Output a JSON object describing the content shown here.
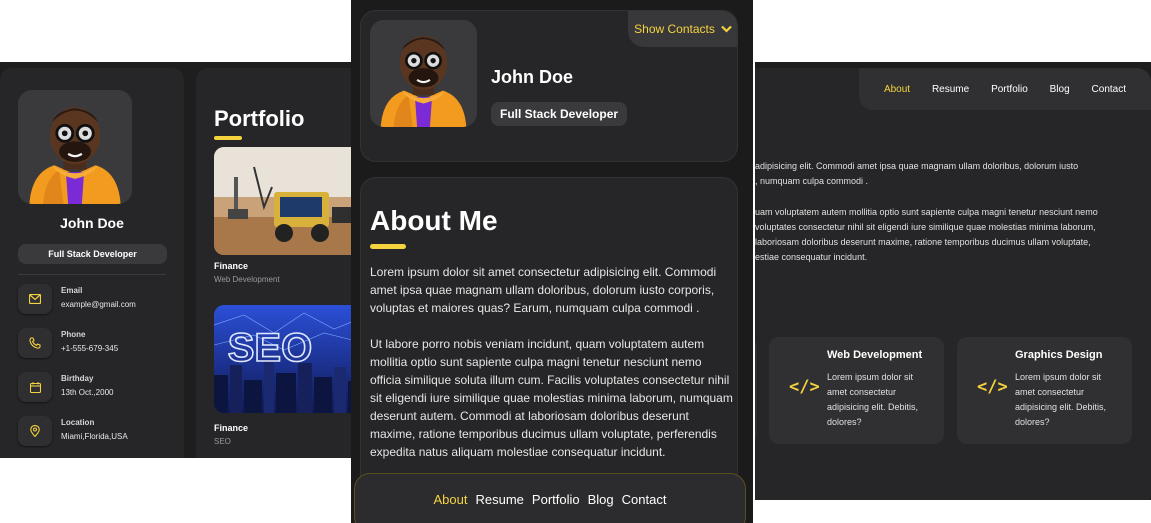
{
  "name": "John Doe",
  "role": "Full Stack Developer",
  "contacts": [
    {
      "label": "Email",
      "value": "example@gmail.com",
      "icon": "mail-icon"
    },
    {
      "label": "Phone",
      "value": "+1-555-679-345",
      "icon": "phone-icon"
    },
    {
      "label": "Birthday",
      "value": "13th Oct.,2000",
      "icon": "calendar-icon"
    },
    {
      "label": "Location",
      "value": "Miami,Florida,USA",
      "icon": "location-pin-icon"
    }
  ],
  "portfolio": {
    "title": "Portfolio",
    "projects": [
      {
        "name": "Finance",
        "category": "Web Development"
      },
      {
        "name": "Finance",
        "category": "SEO",
        "image_text": "SEO"
      }
    ]
  },
  "show_contacts_label": "Show Contacts",
  "about": {
    "title": "About Me",
    "paragraphs": [
      "Lorem ipsum dolor sit amet consectetur adipisicing elit. Commodi amet ipsa quae magnam ullam doloribus, dolorum iusto corporis, voluptas et maiores quas? Earum, numquam culpa commodi .",
      "Ut labore porro nobis veniam incidunt, quam voluptatem autem mollitia optio sunt sapiente culpa magni tenetur nesciunt nemo officia similique soluta illum cum. Facilis voluptates consectetur nihil sit eligendi iure similique quae molestias minima laborum, numquam deserunt autem. Commodi at laboriosam doloribus deserunt maxime, ratione temporibus ducimus ullam voluptate, perferendis expedita natus aliquam molestiae consequatur incidunt."
    ]
  },
  "nav": [
    "About",
    "Resume",
    "Portfolio",
    "Blog",
    "Contact"
  ],
  "nav_active": "About",
  "right_text": [
    "adipisicing elit. Commodi amet ipsa quae magnam ullam doloribus, dolorum iusto",
    ", numquam culpa commodi .",
    "uam voluptatem autem mollitia optio sunt sapiente culpa magni tenetur nesciunt nemo",
    " voluptates consectetur nihil sit eligendi iure similique quae molestias minima laborum,",
    " laboriosam doloribus deserunt maxime, ratione temporibus ducimus ullam voluptate,",
    "estiae consequatur incidunt."
  ],
  "services": [
    {
      "title": "Web Development",
      "text": "Lorem ipsum dolor sit amet consectetur adipisicing elit. Debitis, dolores?",
      "icon": "code-icon"
    },
    {
      "title": "Graphics Design",
      "text": "Lorem ipsum dolor sit amet consectetur adipisicing elit. Debitis, dolores?",
      "icon": "code-icon"
    }
  ],
  "colors": {
    "accent": "#f5d33e",
    "background": "#1e1e1f",
    "card": "#262628"
  }
}
